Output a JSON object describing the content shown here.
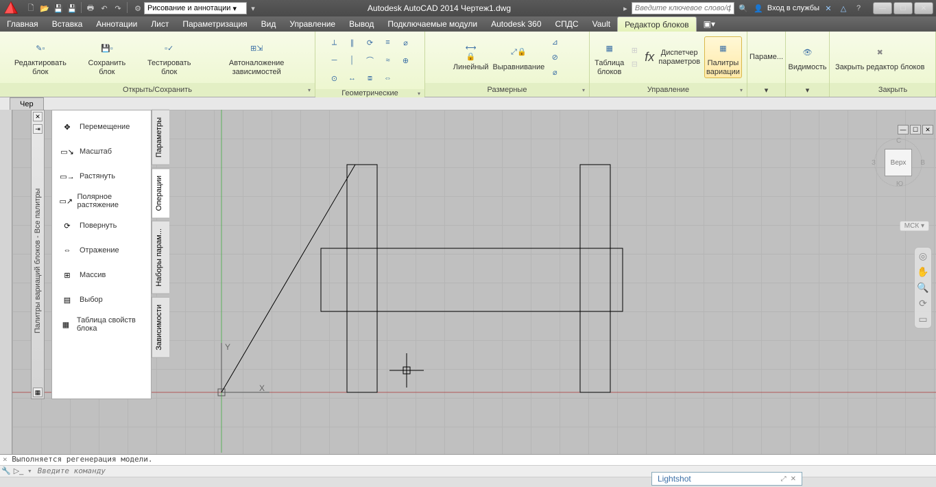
{
  "titlebar": {
    "workspace": "Рисование и аннотации",
    "title": "Autodesk AutoCAD 2014    Чертеж1.dwg",
    "search_placeholder": "Введите ключевое слово/фразу",
    "signin": "Вход в службы"
  },
  "menu": {
    "items": [
      "Главная",
      "Вставка",
      "Аннотации",
      "Лист",
      "Параметризация",
      "Вид",
      "Управление",
      "Вывод",
      "Подключаемые модули",
      "Autodesk 360",
      "СПДС",
      "Vault",
      "Редактор блоков"
    ],
    "active_index": 12
  },
  "ribbon": {
    "panels": [
      {
        "title": "Открыть/Сохранить",
        "buttons": [
          {
            "label": "Редактировать блок",
            "name": "edit-block-button"
          },
          {
            "label": "Сохранить блок",
            "name": "save-block-button"
          },
          {
            "label": "Тестировать блок",
            "name": "test-block-button"
          },
          {
            "label": "Автоналожение зависимостей",
            "name": "auto-constrain-button"
          }
        ]
      },
      {
        "title": "Геометрические",
        "buttons": []
      },
      {
        "title": "Размерные",
        "buttons": [
          {
            "label": "Линейный",
            "name": "linear-button"
          },
          {
            "label": "Выравнивание",
            "name": "align-button"
          }
        ]
      },
      {
        "title": "Управление",
        "buttons": [
          {
            "label": "Таблица блоков",
            "name": "block-table-button"
          },
          {
            "label": "Диспетчер параметров",
            "name": "param-manager-button"
          },
          {
            "label": "Палитры вариации",
            "name": "variation-palettes-button",
            "highlight": true
          }
        ]
      },
      {
        "title": "",
        "buttons": [
          {
            "label": "Параме...",
            "name": "parameters-dropdown"
          }
        ]
      },
      {
        "title": "",
        "buttons": [
          {
            "label": "Видимость",
            "name": "visibility-dropdown"
          }
        ]
      },
      {
        "title": "Закрыть",
        "buttons": [
          {
            "label": "Закрыть редактор блоков",
            "name": "close-block-editor-button"
          }
        ]
      }
    ],
    "fx_label": "fx"
  },
  "canvas": {
    "tab": "Чер",
    "axis_x": "X",
    "axis_y": "Y",
    "view_cube": "Верх",
    "msk": "МСК",
    "coord_compass": {
      "n": "С",
      "s": "Ю",
      "e": "В",
      "w": "З"
    }
  },
  "palette_strip": {
    "title": "Палитры вариаций блоков - Все палитры"
  },
  "palette": {
    "items": [
      {
        "label": "Перемещение",
        "name": "move-item"
      },
      {
        "label": "Масштаб",
        "name": "scale-item"
      },
      {
        "label": "Растянуть",
        "name": "stretch-item"
      },
      {
        "label": "Полярное растяжение",
        "name": "polar-stretch-item"
      },
      {
        "label": "Повернуть",
        "name": "rotate-item"
      },
      {
        "label": "Отражение",
        "name": "mirror-item"
      },
      {
        "label": "Массив",
        "name": "array-item"
      },
      {
        "label": "Выбор",
        "name": "lookup-item"
      },
      {
        "label": "Таблица свойств блока",
        "name": "block-props-table-item"
      }
    ]
  },
  "side_tabs": {
    "items": [
      "Параметры",
      "Операции",
      "Наборы парам...",
      "Зависимости"
    ],
    "active_index": 1
  },
  "lightshot": {
    "label": "Lightshot"
  },
  "cmd": {
    "history": "Выполняется регенерация модели.",
    "prompt_placeholder": "Введите команду"
  }
}
